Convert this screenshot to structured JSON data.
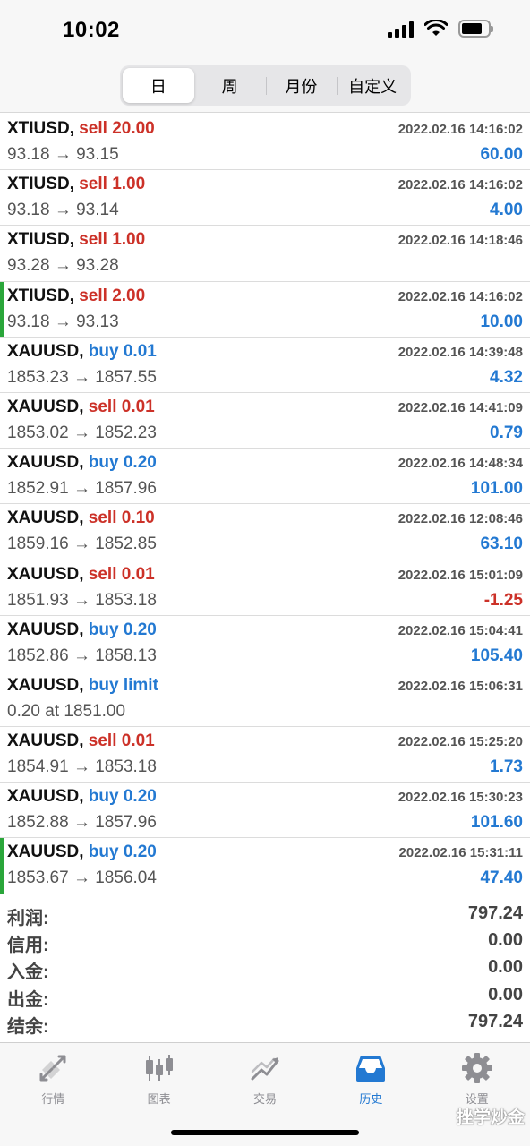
{
  "status_bar": {
    "time": "10:02"
  },
  "segment_tabs": [
    "日",
    "周",
    "月份",
    "自定义"
  ],
  "trades": [
    {
      "symbol": "XTIUSD,",
      "side": "sell",
      "detail": "sell 20.00",
      "time": "2022.02.16 14:16:02",
      "prices": "93.18 → 93.15",
      "profit": "60.00",
      "marked": false
    },
    {
      "symbol": "XTIUSD,",
      "side": "sell",
      "detail": "sell 1.00",
      "time": "2022.02.16 14:16:02",
      "prices": "93.18 → 93.14",
      "profit": "4.00",
      "marked": false
    },
    {
      "symbol": "XTIUSD,",
      "side": "sell",
      "detail": "sell 1.00",
      "time": "2022.02.16 14:18:46",
      "prices": "93.28 → 93.28",
      "profit": "",
      "marked": false
    },
    {
      "symbol": "XTIUSD,",
      "side": "sell",
      "detail": "sell 2.00",
      "time": "2022.02.16 14:16:02",
      "prices": "93.18 → 93.13",
      "profit": "10.00",
      "marked": true
    },
    {
      "symbol": "XAUUSD,",
      "side": "buy",
      "detail": "buy 0.01",
      "time": "2022.02.16 14:39:48",
      "prices": "1853.23 → 1857.55",
      "profit": "4.32",
      "marked": false
    },
    {
      "symbol": "XAUUSD,",
      "side": "sell",
      "detail": "sell 0.01",
      "time": "2022.02.16 14:41:09",
      "prices": "1853.02 → 1852.23",
      "profit": "0.79",
      "marked": false
    },
    {
      "symbol": "XAUUSD,",
      "side": "buy",
      "detail": "buy 0.20",
      "time": "2022.02.16 14:48:34",
      "prices": "1852.91 → 1857.96",
      "profit": "101.00",
      "marked": false
    },
    {
      "symbol": "XAUUSD,",
      "side": "sell",
      "detail": "sell 0.10",
      "time": "2022.02.16 12:08:46",
      "prices": "1859.16 → 1852.85",
      "profit": "63.10",
      "marked": false
    },
    {
      "symbol": "XAUUSD,",
      "side": "sell",
      "detail": "sell 0.01",
      "time": "2022.02.16 15:01:09",
      "prices": "1851.93 → 1853.18",
      "profit": "-1.25",
      "marked": false
    },
    {
      "symbol": "XAUUSD,",
      "side": "buy",
      "detail": "buy 0.20",
      "time": "2022.02.16 15:04:41",
      "prices": "1852.86 → 1858.13",
      "profit": "105.40",
      "marked": false
    },
    {
      "symbol": "XAUUSD,",
      "side": "buy",
      "detail": "buy limit",
      "time": "2022.02.16 15:06:31",
      "prices": "0.20 at 1851.00",
      "profit": "",
      "marked": false
    },
    {
      "symbol": "XAUUSD,",
      "side": "sell",
      "detail": "sell 0.01",
      "time": "2022.02.16 15:25:20",
      "prices": "1854.91 → 1853.18",
      "profit": "1.73",
      "marked": false
    },
    {
      "symbol": "XAUUSD,",
      "side": "buy",
      "detail": "buy 0.20",
      "time": "2022.02.16 15:30:23",
      "prices": "1852.88 → 1857.96",
      "profit": "101.60",
      "marked": false
    },
    {
      "symbol": "XAUUSD,",
      "side": "buy",
      "detail": "buy 0.20",
      "time": "2022.02.16 15:31:11",
      "prices": "1853.67 → 1856.04",
      "profit": "47.40",
      "marked": true
    }
  ],
  "summary": [
    {
      "label": "利润:",
      "value": "797.24"
    },
    {
      "label": "信用:",
      "value": "0.00"
    },
    {
      "label": "入金:",
      "value": "0.00"
    },
    {
      "label": "出金:",
      "value": "0.00"
    },
    {
      "label": "结余:",
      "value": "797.24"
    }
  ],
  "tab_bar": [
    {
      "label": "行情",
      "icon": "quotes-icon"
    },
    {
      "label": "图表",
      "icon": "chart-icon"
    },
    {
      "label": "交易",
      "icon": "trade-icon"
    },
    {
      "label": "历史",
      "icon": "history-icon"
    },
    {
      "label": "设置",
      "icon": "settings-icon"
    }
  ],
  "watermark": "挫学炒金",
  "colors": {
    "buy": "#2379d2",
    "sell": "#cc3128",
    "accent": "#2379d2",
    "marker": "#2aa63a"
  }
}
